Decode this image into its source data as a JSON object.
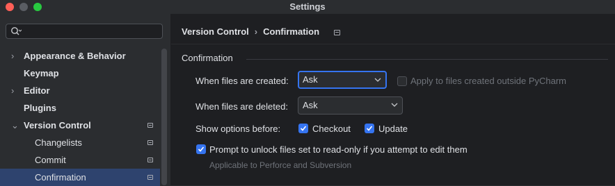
{
  "window": {
    "title": "Settings"
  },
  "search": {
    "placeholder": ""
  },
  "sidebar": {
    "items": [
      {
        "label": "Appearance & Behavior",
        "arrow": "›"
      },
      {
        "label": "Keymap"
      },
      {
        "label": "Editor",
        "arrow": "›"
      },
      {
        "label": "Plugins"
      },
      {
        "label": "Version Control",
        "arrow": "⌄"
      },
      {
        "label": "Changelists"
      },
      {
        "label": "Commit"
      },
      {
        "label": "Confirmation"
      }
    ]
  },
  "breadcrumb": {
    "parent": "Version Control",
    "separator": "›",
    "current": "Confirmation"
  },
  "section": {
    "title": "Confirmation"
  },
  "form": {
    "created_label": "When files are created:",
    "created_value": "Ask",
    "apply_outside_label": "Apply to files created outside PyCharm",
    "deleted_label": "When files are deleted:",
    "deleted_value": "Ask",
    "show_options_label": "Show options before:",
    "checkout_label": "Checkout",
    "update_label": "Update",
    "prompt_unlock_label": "Prompt to unlock files set to read-only if you attempt to edit them",
    "prompt_unlock_hint": "Applicable to Perforce and Subversion"
  },
  "colors": {
    "accent": "#3574f0",
    "selection": "#2e436e"
  }
}
